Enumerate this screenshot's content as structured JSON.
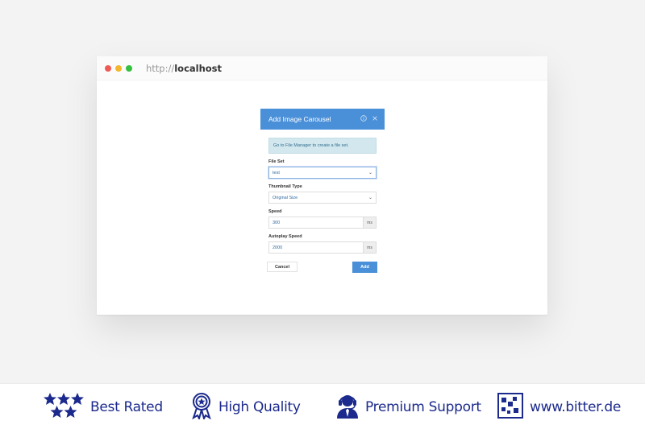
{
  "browser": {
    "url_scheme": "http://",
    "url_host": "localhost",
    "dot_colors": [
      "#ee5b55",
      "#f5b62f",
      "#36c03f"
    ]
  },
  "dialog": {
    "title": "Add Image Carousel",
    "info_icon": "info-icon",
    "close_icon": "close-icon",
    "alert_text": "Go to File Manager to create a file set.",
    "file_set": {
      "label": "File Set",
      "value": "test"
    },
    "thumbnail_type": {
      "label": "Thumbnail Type",
      "value": "Original Size"
    },
    "speed": {
      "label": "Speed",
      "value": "300",
      "unit": "ms"
    },
    "autoplay_speed": {
      "label": "Autoplay Speed",
      "value": "2000",
      "unit": "ms"
    },
    "cancel_label": "Cancel",
    "add_label": "Add"
  },
  "footer": {
    "items": [
      {
        "label": "Best Rated",
        "icon": "stars-icon"
      },
      {
        "label": "High Quality",
        "icon": "award-badge-icon"
      },
      {
        "label": "Premium Support",
        "icon": "headset-support-icon"
      },
      {
        "label": "www.bitter.de",
        "icon": "bitter-logo-icon"
      }
    ],
    "color": "#1b2a8c"
  },
  "colors": {
    "accent": "#4a90d9",
    "alert_bg": "#d3e7ee"
  }
}
